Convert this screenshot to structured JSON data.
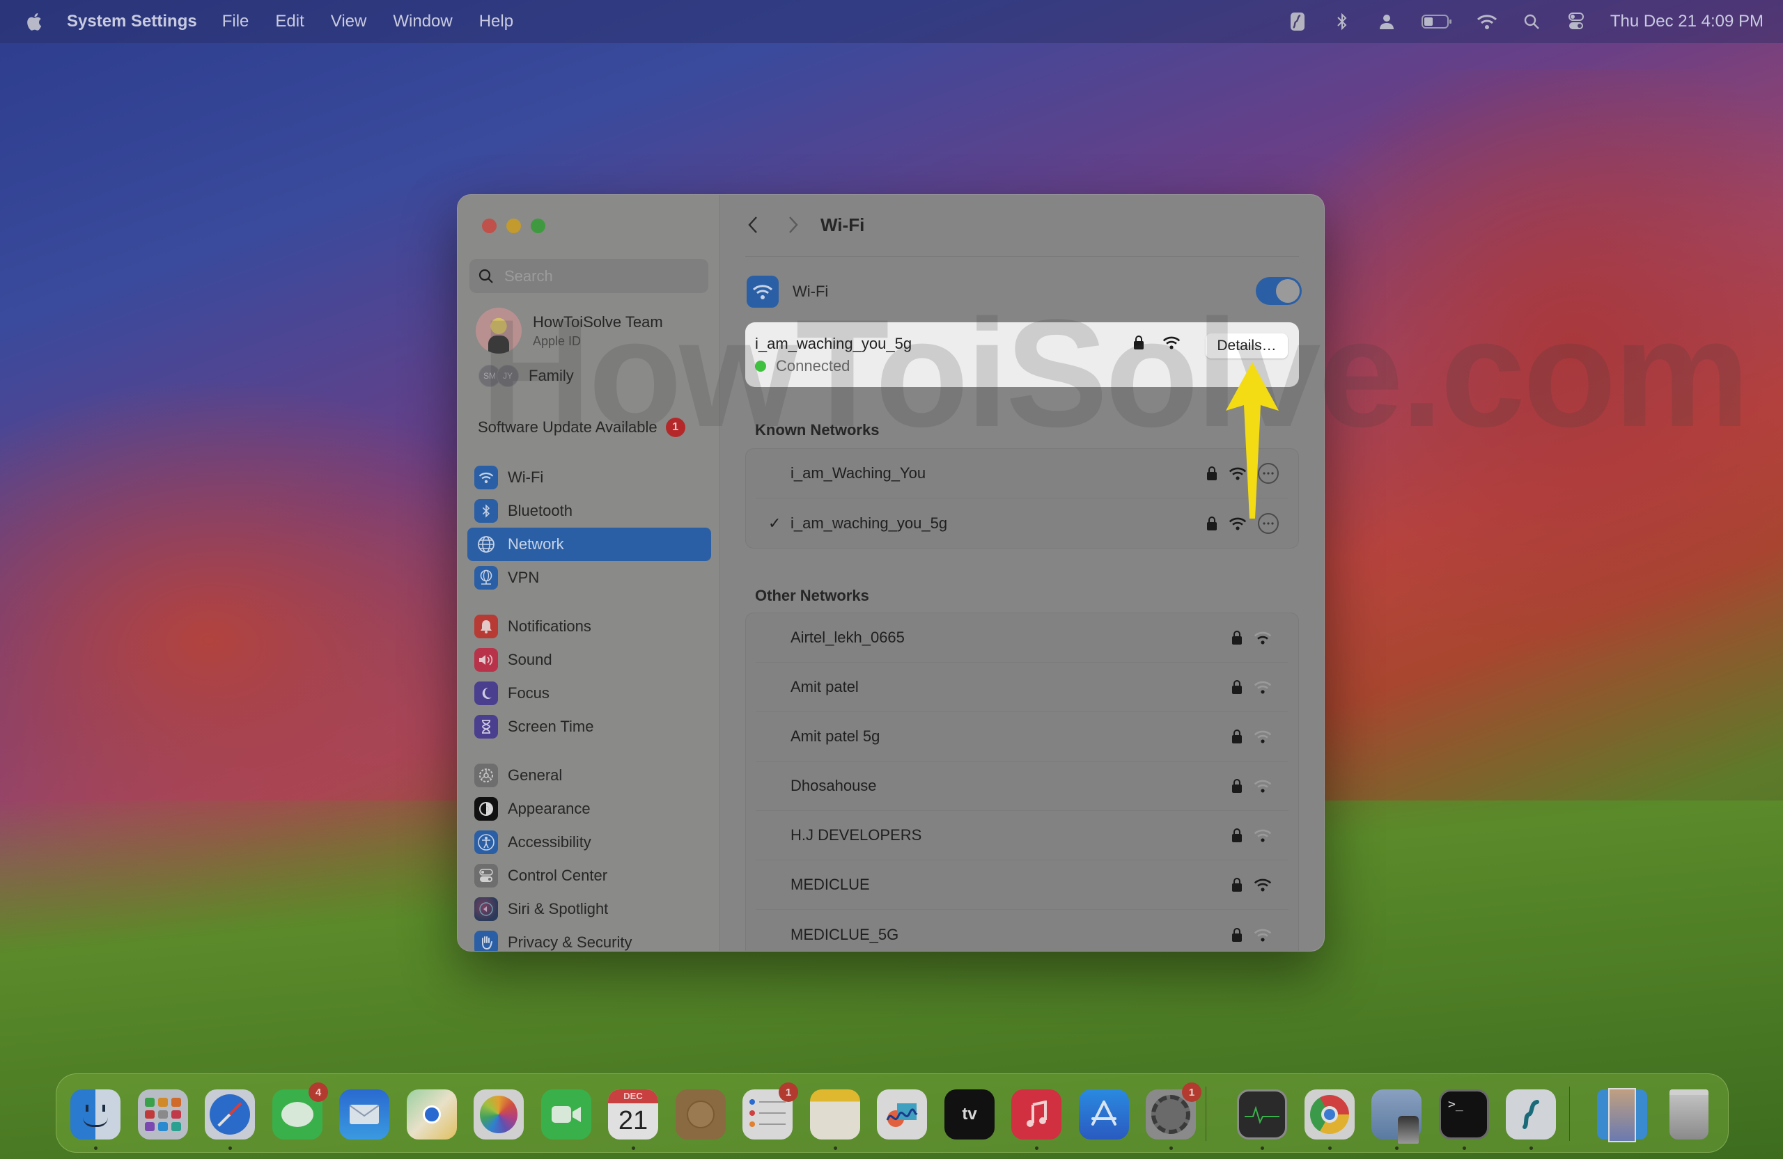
{
  "menubar": {
    "app_name": "System Settings",
    "items": [
      "File",
      "Edit",
      "View",
      "Window",
      "Help"
    ],
    "status_icons": [
      "surfshark-icon",
      "bluetooth-icon",
      "user-icon",
      "battery-icon",
      "wifi-icon",
      "search-icon",
      "control-center-icon"
    ],
    "datetime": "Thu Dec 21  4:09 PM"
  },
  "sidebar": {
    "search_placeholder": "Search",
    "profile": {
      "name": "HowToiSolve Team",
      "subtitle": "Apple ID"
    },
    "family": {
      "label": "Family",
      "initials": [
        "SM",
        "JY"
      ]
    },
    "software_update": {
      "label": "Software Update Available",
      "badge": "1"
    },
    "items": [
      {
        "label": "Wi-Fi",
        "icon": "wifi-icon",
        "color": "#2a5fa6"
      },
      {
        "label": "Bluetooth",
        "icon": "bluetooth-icon",
        "color": "#2a5fa6"
      },
      {
        "label": "Network",
        "icon": "globe-icon",
        "color": "#2a5fa6",
        "selected": true
      },
      {
        "label": "VPN",
        "icon": "vpn-globe-icon",
        "color": "#2a5fa6"
      },
      {
        "label": "Notifications",
        "icon": "bell-icon",
        "color": "#b83a34"
      },
      {
        "label": "Sound",
        "icon": "speaker-icon",
        "color": "#b8334a"
      },
      {
        "label": "Focus",
        "icon": "moon-icon",
        "color": "#4a3f8f"
      },
      {
        "label": "Screen Time",
        "icon": "hourglass-icon",
        "color": "#4a3f8f"
      },
      {
        "label": "General",
        "icon": "gear-icon",
        "color": "#6e6e6e"
      },
      {
        "label": "Appearance",
        "icon": "appearance-icon",
        "color": "#111111"
      },
      {
        "label": "Accessibility",
        "icon": "accessibility-icon",
        "color": "#2a5fa6"
      },
      {
        "label": "Control Center",
        "icon": "control-center-icon",
        "color": "#6e6e6e"
      },
      {
        "label": "Siri & Spotlight",
        "icon": "siri-icon",
        "color": "#3a3a5a"
      },
      {
        "label": "Privacy & Security",
        "icon": "hand-icon",
        "color": "#2a5fa6"
      }
    ]
  },
  "main": {
    "title": "Wi-Fi",
    "wifi_toggle": {
      "label": "Wi-Fi",
      "on": true
    },
    "current_network": {
      "name": "i_am_waching_you_5g",
      "status": "Connected",
      "details_label": "Details…"
    },
    "known_networks_title": "Known Networks",
    "known_networks": [
      {
        "name": "i_am_Waching_You",
        "connected": false,
        "locked": true,
        "signal": "full"
      },
      {
        "name": "i_am_waching_you_5g",
        "connected": true,
        "locked": true,
        "signal": "full"
      }
    ],
    "other_networks_title": "Other Networks",
    "other_networks": [
      {
        "name": "Airtel_lekh_0665",
        "locked": true,
        "signal": "medium"
      },
      {
        "name": "Amit patel",
        "locked": true,
        "signal": "weak"
      },
      {
        "name": "Amit patel 5g",
        "locked": true,
        "signal": "weak"
      },
      {
        "name": "Dhosahouse",
        "locked": true,
        "signal": "weak"
      },
      {
        "name": "H.J DEVELOPERS",
        "locked": true,
        "signal": "weak"
      },
      {
        "name": "MEDICLUE",
        "locked": true,
        "signal": "full"
      },
      {
        "name": "MEDICLUE_5G",
        "locked": true,
        "signal": "weak"
      }
    ]
  },
  "watermark": "HowToiSolve.com",
  "dock": {
    "calendar": {
      "month": "DEC",
      "day": "21"
    },
    "apps": [
      {
        "name": "Finder",
        "running": true
      },
      {
        "name": "Launchpad"
      },
      {
        "name": "Safari",
        "running": true
      },
      {
        "name": "Messages",
        "badge": "4"
      },
      {
        "name": "Mail"
      },
      {
        "name": "Maps"
      },
      {
        "name": "Photos"
      },
      {
        "name": "FaceTime"
      },
      {
        "name": "Calendar",
        "running": true
      },
      {
        "name": "Contacts"
      },
      {
        "name": "Reminders",
        "badge": "1"
      },
      {
        "name": "Notes",
        "running": true
      },
      {
        "name": "Freeform"
      },
      {
        "name": "Apple TV"
      },
      {
        "name": "Music",
        "running": true
      },
      {
        "name": "App Store"
      },
      {
        "name": "System Settings",
        "badge": "1",
        "running": true
      },
      {
        "name": "Activity Monitor",
        "running": true
      },
      {
        "name": "Google Chrome",
        "running": true
      },
      {
        "name": "Preview",
        "running": true
      },
      {
        "name": "Terminal",
        "running": true
      },
      {
        "name": "Surfshark",
        "running": true
      },
      {
        "name": "Downloads"
      },
      {
        "name": "Trash"
      }
    ]
  }
}
